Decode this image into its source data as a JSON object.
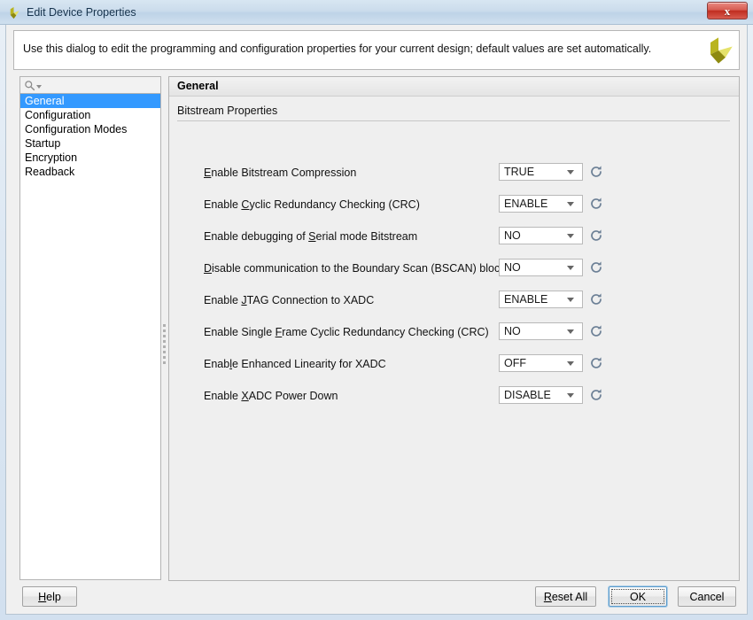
{
  "window": {
    "title": "Edit Device Properties",
    "close_label": "✕",
    "logo_icon": "xilinx-logo-icon"
  },
  "banner": {
    "text": "Use this dialog to edit the programming and configuration properties for your current design; default values are set automatically.",
    "logo_icon": "xilinx-logo-icon"
  },
  "sidebar": {
    "search": {
      "value": "",
      "placeholder": "",
      "icon": "search-icon",
      "dropdown_icon": "chevron-down-icon"
    },
    "items": [
      {
        "label": "General",
        "selected": true
      },
      {
        "label": "Configuration",
        "selected": false
      },
      {
        "label": "Configuration Modes",
        "selected": false
      },
      {
        "label": "Startup",
        "selected": false
      },
      {
        "label": "Encryption",
        "selected": false
      },
      {
        "label": "Readback",
        "selected": false
      }
    ]
  },
  "page": {
    "header_title": "General",
    "section_label": "Bitstream Properties",
    "properties": [
      {
        "label_pre": "",
        "label_mnemonic": "E",
        "label_post": "nable Bitstream Compression",
        "value": "TRUE",
        "reset_icon": "refresh-icon",
        "dropdown_icon": "chevron-down-icon"
      },
      {
        "label_pre": "Enable ",
        "label_mnemonic": "C",
        "label_post": "yclic Redundancy Checking (CRC)",
        "value": "ENABLE",
        "reset_icon": "refresh-icon",
        "dropdown_icon": "chevron-down-icon"
      },
      {
        "label_pre": "Enable debugging of ",
        "label_mnemonic": "S",
        "label_post": "erial mode Bitstream",
        "value": "NO",
        "reset_icon": "refresh-icon",
        "dropdown_icon": "chevron-down-icon"
      },
      {
        "label_pre": "",
        "label_mnemonic": "D",
        "label_post": "isable communication to the Boundary Scan (BSCAN) block via JTAG",
        "value": "NO",
        "reset_icon": "refresh-icon",
        "dropdown_icon": "chevron-down-icon"
      },
      {
        "label_pre": "Enable ",
        "label_mnemonic": "J",
        "label_post": "TAG Connection to XADC",
        "value": "ENABLE",
        "reset_icon": "refresh-icon",
        "dropdown_icon": "chevron-down-icon"
      },
      {
        "label_pre": "Enable Single ",
        "label_mnemonic": "F",
        "label_post": "rame Cyclic Redundancy Checking (CRC)",
        "value": "NO",
        "reset_icon": "refresh-icon",
        "dropdown_icon": "chevron-down-icon"
      },
      {
        "label_pre": "Enab",
        "label_mnemonic": "l",
        "label_post": "e Enhanced Linearity for XADC",
        "value": "OFF",
        "reset_icon": "refresh-icon",
        "dropdown_icon": "chevron-down-icon"
      },
      {
        "label_pre": "Enable ",
        "label_mnemonic": "X",
        "label_post": "ADC Power Down",
        "value": "DISABLE",
        "reset_icon": "refresh-icon",
        "dropdown_icon": "chevron-down-icon"
      }
    ]
  },
  "buttons": {
    "help": {
      "pre": "",
      "mnemonic": "H",
      "post": "elp"
    },
    "reset_all": {
      "pre": "",
      "mnemonic": "R",
      "post": "eset All"
    },
    "ok": {
      "pre": "OK",
      "mnemonic": "",
      "post": ""
    },
    "cancel": {
      "pre": "Cancel",
      "mnemonic": "",
      "post": ""
    }
  },
  "colors": {
    "selection": "#3399ff",
    "accent_logo": "#c8c832",
    "close_button": "#c02d20",
    "focus_border": "#5c9ccc"
  }
}
